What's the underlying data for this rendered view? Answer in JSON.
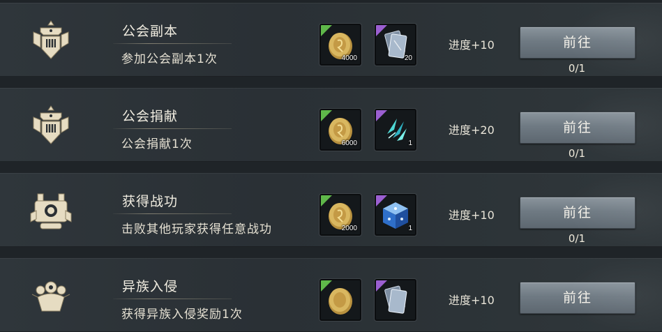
{
  "tasks": [
    {
      "title": "公会副本",
      "desc": "参加公会副本1次",
      "rewards": [
        {
          "icon": "gold-coin-icon",
          "qty": "4000",
          "rarity": "green"
        },
        {
          "icon": "card-pack-icon",
          "qty": "20",
          "rarity": "purple"
        }
      ],
      "progress": "进度+10",
      "button": "前往",
      "count": "0/1",
      "emblem": "guild-banner-icon"
    },
    {
      "title": "公会捐献",
      "desc": "公会捐献1次",
      "rewards": [
        {
          "icon": "gold-coin-icon",
          "qty": "6000",
          "rarity": "green"
        },
        {
          "icon": "crystal-shard-icon",
          "qty": "1",
          "rarity": "purple"
        }
      ],
      "progress": "进度+20",
      "button": "前往",
      "count": "0/1",
      "emblem": "guild-banner-icon"
    },
    {
      "title": "获得战功",
      "desc": "击败其他玩家获得任意战功",
      "rewards": [
        {
          "icon": "gold-coin-icon",
          "qty": "2000",
          "rarity": "green"
        },
        {
          "icon": "magic-cube-icon",
          "qty": "1",
          "rarity": "purple"
        }
      ],
      "progress": "进度+10",
      "button": "前往",
      "count": "0/1",
      "emblem": "war-machine-icon"
    },
    {
      "title": "异族入侵",
      "desc": "获得异族入侵奖励1次",
      "rewards": [
        {
          "icon": "gold-coin-icon",
          "qty": "",
          "rarity": "green"
        },
        {
          "icon": "card-pack-icon",
          "qty": "",
          "rarity": "purple"
        }
      ],
      "progress": "进度+10",
      "button": "前往",
      "count": "",
      "emblem": "alien-invasion-icon"
    }
  ],
  "colors": {
    "green_rarity": "#5fb84a",
    "purple_rarity": "#9b5fd1",
    "button": "#76818a"
  }
}
